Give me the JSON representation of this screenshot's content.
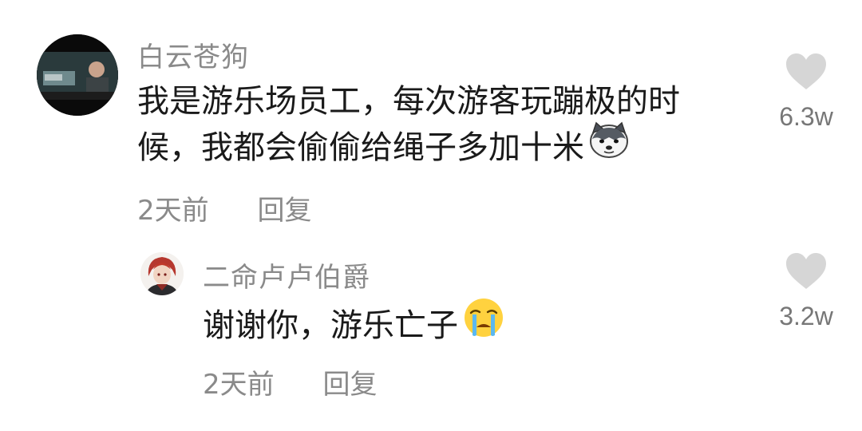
{
  "comments": [
    {
      "username": "白云苍狗",
      "text_lines": [
        "我是游乐场员工，每次游客玩蹦极的时",
        "候，我都会偷偷给绳子多加十米"
      ],
      "emoji": "husky-dog-emoji",
      "time": "2天前",
      "reply_label": "回复",
      "likes": "6.3w"
    },
    {
      "username": "二命卢卢伯爵",
      "text_lines": [
        "谢谢你，游乐亡子"
      ],
      "emoji": "crying-face-emoji",
      "time": "2天前",
      "reply_label": "回复",
      "likes": "3.2w"
    }
  ],
  "colors": {
    "text": "#1a1a1a",
    "muted": "#8a8a8a",
    "heart": "#d6d6d6"
  }
}
